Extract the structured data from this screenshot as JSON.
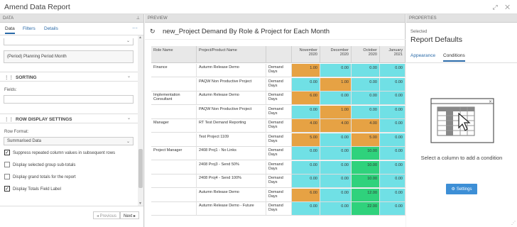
{
  "window": {
    "title": "Amend Data Report",
    "icons": "⤢ ✕"
  },
  "left": {
    "header": "DATA",
    "pin": "⊥",
    "tabs": [
      {
        "label": "Data"
      },
      {
        "label": "Filters"
      },
      {
        "label": "Details"
      }
    ],
    "more": "···",
    "period_field": "(Period) Planning Period Month",
    "sorting": {
      "title": "SORTING",
      "fields_label": "Fields:"
    },
    "row_display": {
      "title": "ROW DISPLAY SETTINGS",
      "row_format_label": "Row Format:",
      "row_format_value": "Summarised Data",
      "options": [
        {
          "label": "Suppress repeated column values in subsequent rows",
          "checked": true
        },
        {
          "label": "Display selected group sub-totals",
          "checked": false
        },
        {
          "label": "Display grand totals for the report",
          "checked": false
        },
        {
          "label": "Display Totals Field Label",
          "checked": true
        }
      ]
    },
    "nav": {
      "previous": "◂ Previous",
      "next": "Next ▸"
    }
  },
  "preview": {
    "header": "PREVIEW",
    "refresh_icon": "↻",
    "report_title": "new_Project Demand By Role & Project for Each Month",
    "columns": [
      {
        "label": "Role Name"
      },
      {
        "label": "Project/Product Name"
      },
      {
        "label": ""
      },
      {
        "label": "November 2020"
      },
      {
        "label": "December 2020"
      },
      {
        "label": "October 2020"
      },
      {
        "label": "January 2021"
      }
    ],
    "rows": [
      {
        "role": "Finance",
        "project": "Autumn Release Demo",
        "measure": "Demand Days",
        "values": [
          "1.00",
          "0.00",
          "0.00",
          "0.00"
        ]
      },
      {
        "role": "",
        "project": "PAQW Non Productive Project",
        "measure": "Demand Days",
        "values": [
          "0.00",
          "1.00",
          "0.00",
          "0.00"
        ]
      },
      {
        "role": "Implementation Consultant",
        "project": "Autumn Release Demo",
        "measure": "Demand Days",
        "values": [
          "6.00",
          "0.00",
          "0.00",
          "0.00"
        ]
      },
      {
        "role": "",
        "project": "PAQW Non Productive Project",
        "measure": "Demand Days",
        "values": [
          "0.00",
          "1.00",
          "0.00",
          "0.00"
        ]
      },
      {
        "role": "Manager",
        "project": "RT Test Demand Reporting",
        "measure": "Demand Days",
        "values": [
          "4.00",
          "4.00",
          "4.00",
          "0.00"
        ]
      },
      {
        "role": "",
        "project": "Test Project 1109",
        "measure": "Demand Days",
        "values": [
          "5.00",
          "0.00",
          "5.00",
          "0.00"
        ]
      },
      {
        "role": "Project Manager",
        "project": "2408 Proj1 - No Links",
        "measure": "Demand Days",
        "values": [
          "0.00",
          "0.00",
          "10.00",
          "0.00"
        ]
      },
      {
        "role": "",
        "project": "2408 Proj3 - Send 50%",
        "measure": "Demand Days",
        "values": [
          "0.00",
          "0.00",
          "10.00",
          "0.00"
        ]
      },
      {
        "role": "",
        "project": "2408 Proj4 - Send 100%",
        "measure": "Demand Days",
        "values": [
          "0.00",
          "0.00",
          "10.00",
          "0.00"
        ]
      },
      {
        "role": "",
        "project": "Autumn Release Demo",
        "measure": "Demand Days",
        "values": [
          "6.00",
          "0.00",
          "12.00",
          "0.00"
        ]
      },
      {
        "role": "",
        "project": "Autumn Release Demo - Future",
        "measure": "Demand Days",
        "values": [
          "0.00",
          "0.00",
          "22.00",
          "0.00"
        ]
      }
    ],
    "colors": {
      "orange": "#e6a244",
      "cyan": "#70e0e5",
      "green": "#2fd27c"
    }
  },
  "right": {
    "header": "PROPERTIES",
    "selected_label": "Selected",
    "selected_value": "Report Defaults",
    "tabs": [
      {
        "label": "Appearance"
      },
      {
        "label": "Conditions"
      }
    ],
    "hint": "Select a column to add a condition",
    "settings_label": "Settings",
    "accent": "#3d8fd6"
  }
}
